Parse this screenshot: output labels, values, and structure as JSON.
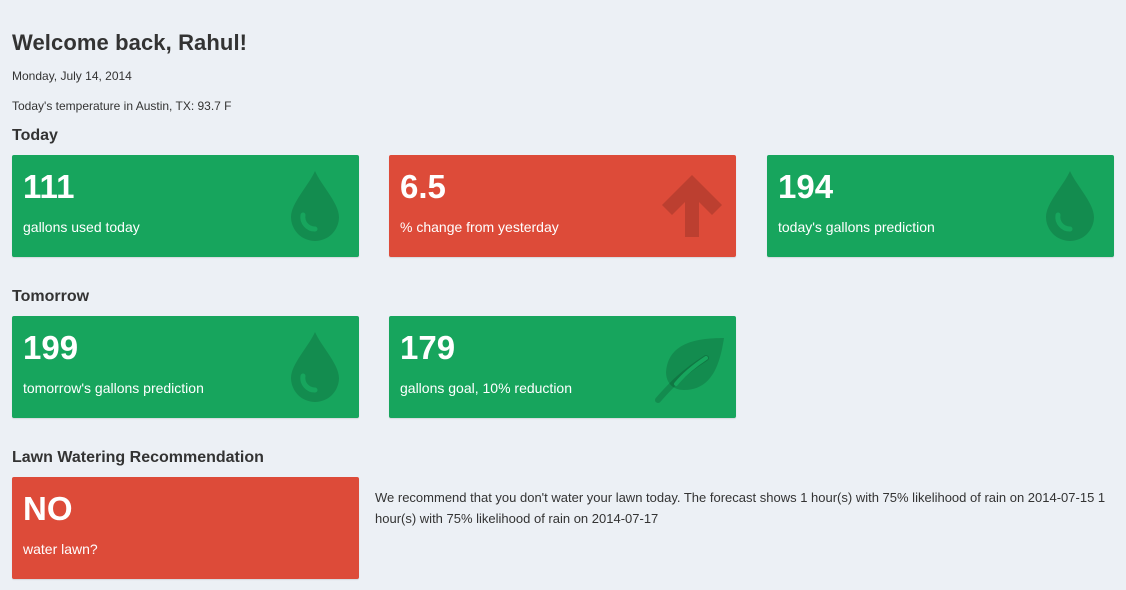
{
  "header": {
    "welcome": "Welcome back, Rahul!",
    "date": "Monday, July 14, 2014",
    "temperature": "Today's temperature in Austin, TX: 93.7 F"
  },
  "sections": {
    "today": "Today",
    "tomorrow": "Tomorrow",
    "lawn": "Lawn Watering Recommendation"
  },
  "today": {
    "gallons_used": {
      "value": "111",
      "label": "gallons used today",
      "icon": "water-drop-icon"
    },
    "change": {
      "value": "6.5",
      "label": "% change from yesterday",
      "icon": "arrow-up-icon"
    },
    "prediction": {
      "value": "194",
      "label": "today's gallons prediction",
      "icon": "water-drop-icon"
    }
  },
  "tomorrow": {
    "prediction": {
      "value": "199",
      "label": "tomorrow's gallons prediction",
      "icon": "water-drop-icon"
    },
    "goal": {
      "value": "179",
      "label": "gallons goal, 10% reduction",
      "icon": "leaf-icon"
    }
  },
  "lawn": {
    "value": "NO",
    "label": "water lawn?",
    "recommendation": "We recommend that you don't water your lawn today. The forecast shows 1 hour(s) with 75% likelihood of rain on 2014-07-15 1 hour(s) with 75% likelihood of rain on 2014-07-17"
  },
  "colors": {
    "green": "#17a55d",
    "red": "#dd4b39",
    "background": "#ecf0f5"
  }
}
